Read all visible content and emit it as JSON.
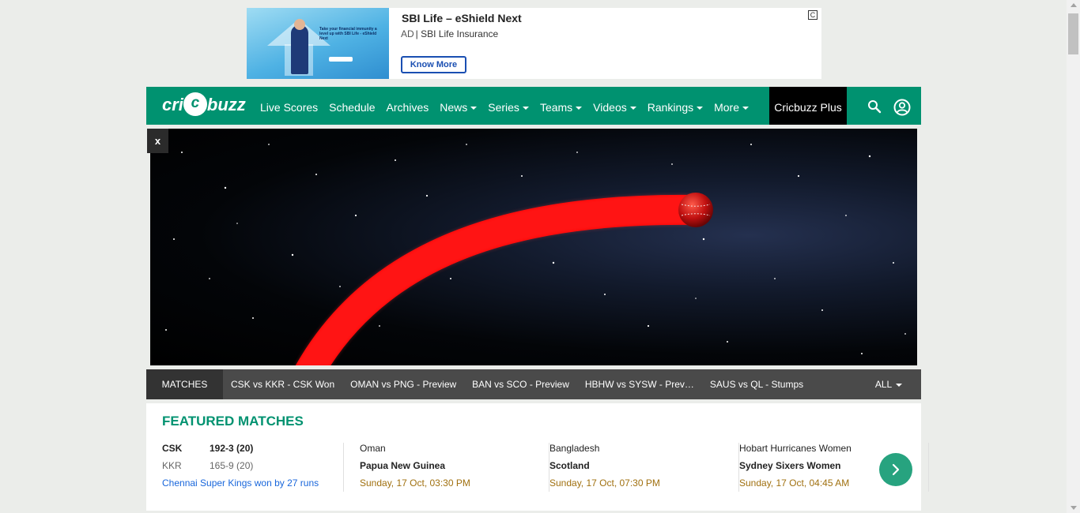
{
  "ad": {
    "title": "SBI Life – eShield Next",
    "ad_tag": "AD",
    "advertiser": "SBI Life Insurance",
    "button_label": "Know More",
    "choice_icon": "adchoices-icon",
    "image_text": "Take your financial immunity a level up with SBI Life - eShield Next"
  },
  "nav": {
    "logo": {
      "prefix": "cri",
      "circle": "c",
      "suffix": "buzz"
    },
    "items": [
      {
        "label": "Live Scores",
        "dropdown": false
      },
      {
        "label": "Schedule",
        "dropdown": false
      },
      {
        "label": "Archives",
        "dropdown": false
      },
      {
        "label": "News",
        "dropdown": true
      },
      {
        "label": "Series",
        "dropdown": true
      },
      {
        "label": "Teams",
        "dropdown": true
      },
      {
        "label": "Videos",
        "dropdown": true
      },
      {
        "label": "Rankings",
        "dropdown": true
      },
      {
        "label": "More",
        "dropdown": true
      }
    ],
    "plus_label": "Cricbuzz Plus",
    "search_icon": "search-icon",
    "user_icon": "user-account-icon",
    "brand_color": "#009270"
  },
  "hero": {
    "close_label": "x"
  },
  "matches_strip": {
    "label": "MATCHES",
    "items": [
      "CSK vs KKR - CSK Won",
      "OMAN vs PNG - Preview",
      "BAN vs SCO - Preview",
      "HBHW vs SYSW - Prev…",
      "SAUS vs QL - Stumps"
    ],
    "all_label": "ALL"
  },
  "featured": {
    "title": "FEATURED MATCHES",
    "cards": [
      {
        "team1": "CSK",
        "score1": "192-3 (20)",
        "team2": "KKR",
        "score2": "165-9 (20)",
        "status": "Chennai Super Kings won by 27 runs"
      },
      {
        "team1": "Oman",
        "team2": "Papua New Guinea",
        "status": "Sunday, 17 Oct, 03:30 PM"
      },
      {
        "team1": "Bangladesh",
        "team2": "Scotland",
        "status": "Sunday, 17 Oct, 07:30 PM"
      },
      {
        "team1": "Hobart Hurricanes Women",
        "team2": "Sydney Sixers Women",
        "status": "Sunday, 17 Oct, 04:45 AM"
      }
    ],
    "next_icon": "chevron-right-icon"
  }
}
